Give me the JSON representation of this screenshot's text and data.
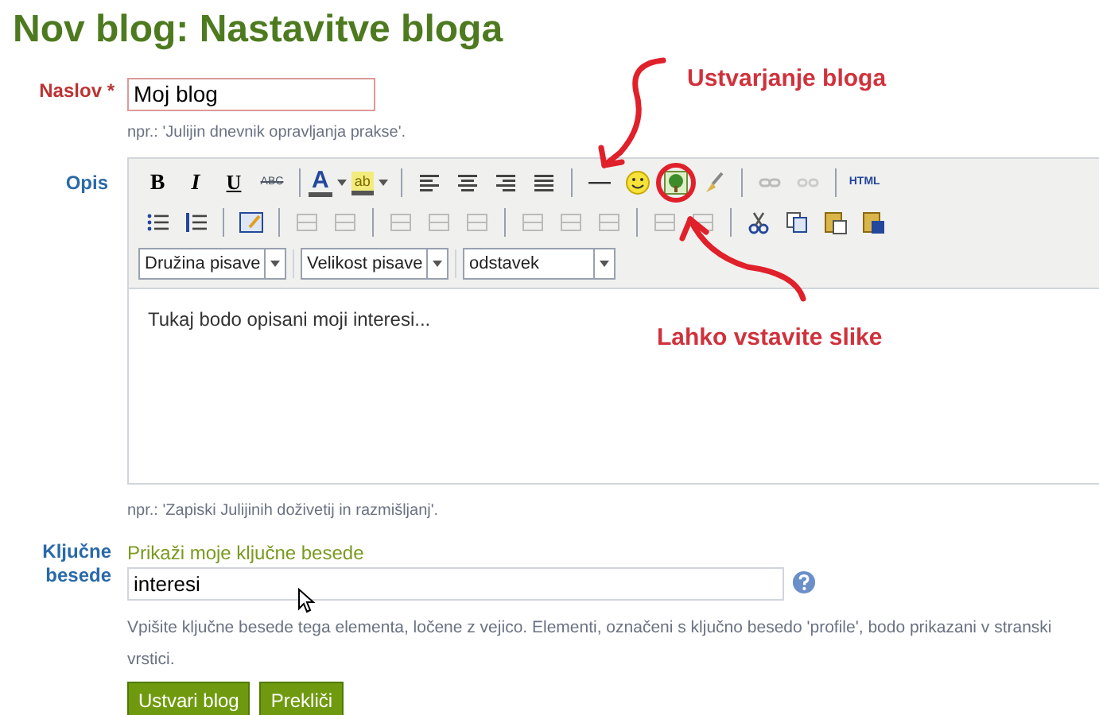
{
  "title": "Nov blog: Nastavitve bloga",
  "fields": {
    "naslov": {
      "label": "Naslov",
      "required_mark": "*",
      "value": "Moj blog",
      "hint": "npr.: 'Julijin dnevnik opravljanja prakse'."
    },
    "opis": {
      "label": "Opis",
      "content": "Tukaj bodo opisani moji interesi...",
      "hint": "npr.: 'Zapiski Julijinih doživetij in razmišljanj'."
    },
    "kljucne": {
      "label": "Ključne besede",
      "link": "Prikaži moje ključne besede",
      "value": "interesi",
      "hint": "Vpišite ključne besede tega elementa, ločene z vejico. Elementi, označeni s ključno besedo 'profile', bodo prikazani v stranski vrstici."
    }
  },
  "toolbar_labels": [
    "B",
    "I",
    "U",
    "ABC",
    "A",
    "ab",
    "HTML"
  ],
  "dropdowns": [
    "Družina pisave",
    "Velikost pisave",
    "odstavek"
  ],
  "buttons": [
    "Ustvari blog",
    "Prekliči"
  ],
  "annotations": [
    "Ustvarjanje bloga",
    "Lahko vstavite slike"
  ]
}
